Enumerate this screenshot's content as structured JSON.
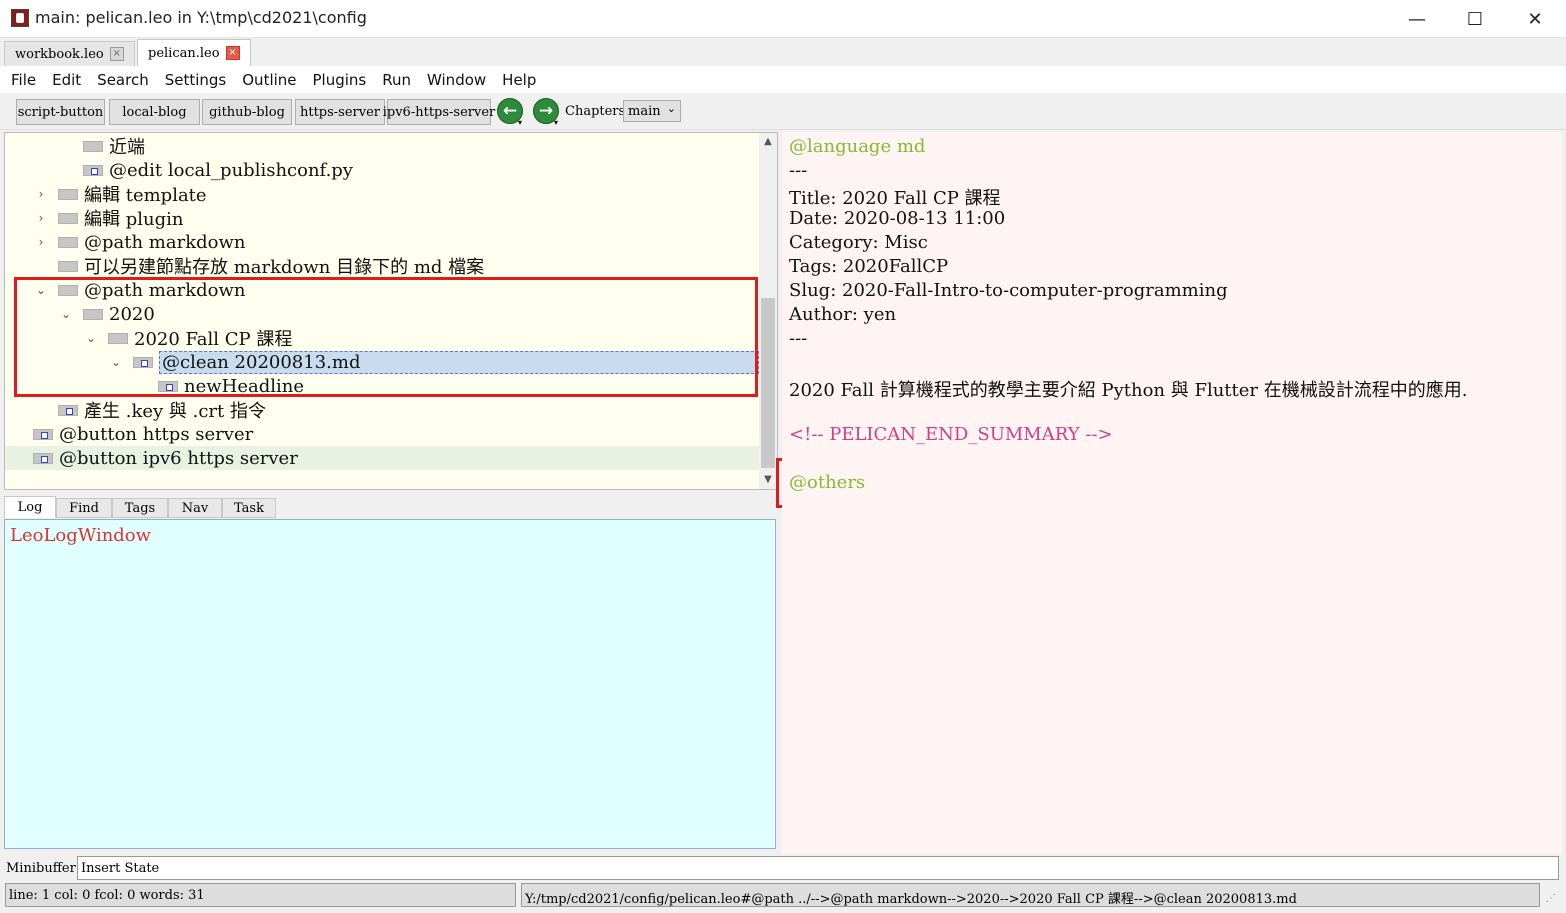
{
  "window": {
    "title": "main: pelican.leo in Y:\\tmp\\cd2021\\config",
    "min_glyph": "—",
    "max_glyph": "☐",
    "close_glyph": "✕"
  },
  "file_tabs": [
    {
      "label": "workbook.leo",
      "close": "×"
    },
    {
      "label": "pelican.leo",
      "close": "×"
    }
  ],
  "menu": [
    "File",
    "Edit",
    "Search",
    "Settings",
    "Outline",
    "Plugins",
    "Run",
    "Window",
    "Help"
  ],
  "toolbar": {
    "buttons": [
      "script-button",
      "local-blog",
      "github-blog",
      "https-server",
      "ipv6-https-server"
    ],
    "back_glyph": "←",
    "forward_glyph": "→",
    "dropdown_glyph": "▾",
    "chapters_label": "Chapters:",
    "chapters_value": "main",
    "chevron": "⌄"
  },
  "outline": {
    "nodes": [
      {
        "text": "近端",
        "caret": ""
      },
      {
        "text": "@edit local_publishconf.py",
        "caret": ""
      },
      {
        "text": "編輯 template",
        "caret": "›"
      },
      {
        "text": "編輯 plugin",
        "caret": "›"
      },
      {
        "text": "@path markdown",
        "caret": "›"
      },
      {
        "text": "可以另建節點存放 markdown 目錄下的 md 檔案",
        "caret": ""
      },
      {
        "text": "@path markdown",
        "caret": "⌄"
      },
      {
        "text": "2020",
        "caret": "⌄"
      },
      {
        "text": "2020 Fall CP 課程",
        "caret": "⌄"
      },
      {
        "text": "@clean 20200813.md",
        "caret": "⌄"
      },
      {
        "text": "newHeadline",
        "caret": ""
      },
      {
        "text": "產生 .key 與 .crt 指令",
        "caret": ""
      },
      {
        "text": "@button https server",
        "caret": ""
      },
      {
        "text": "@button ipv6 https server",
        "caret": ""
      }
    ],
    "scroll_up": "▲",
    "scroll_down": "▼"
  },
  "log": {
    "tabs": [
      "Log",
      "Find",
      "Tags",
      "Nav",
      "Task"
    ],
    "title": "LeoLogWindow"
  },
  "body": {
    "lines": [
      "@language md",
      "---",
      "Title: 2020 Fall CP 課程",
      "Date: 2020-08-13 11:00",
      "Category: Misc",
      "Tags: 2020FallCP",
      "Slug: 2020-Fall-Intro-to-computer-programming",
      "Author: yen",
      "---",
      "2020 Fall 計算機程式的教學主要介紹 Python 與 Flutter 在機械設計流程中的應用.",
      "<!-- PELICAN_END_SUMMARY -->",
      "@others"
    ]
  },
  "minibuffer": {
    "label": "Minibuffer:",
    "value": "Insert State"
  },
  "status": {
    "left": "line: 1 col: 0   fcol: 0 words: 31",
    "right": "Y:/tmp/cd2021/config/pelican.leo#@path ../-->@path markdown-->2020-->2020 Fall CP 課程-->@clean 20200813.md",
    "grip": "⋰"
  },
  "colors": {
    "outline_bg": "#fffff0",
    "log_bg": "#e0ffff",
    "body_bg": "#fff4f4",
    "directive_green": "#8ab830",
    "comment_pink": "#d23e86",
    "highlight_red": "#e01b1b"
  }
}
